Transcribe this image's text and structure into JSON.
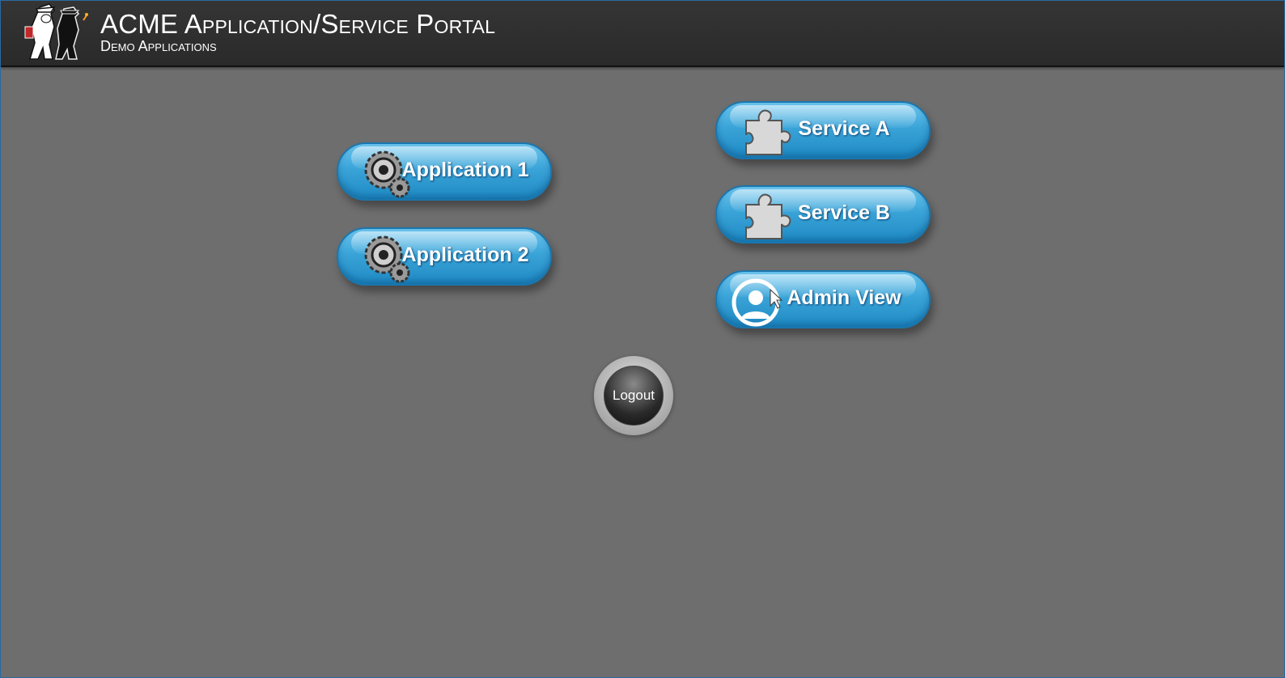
{
  "header": {
    "title": "ACME Application/Service Portal",
    "subtitle": "Demo Applications",
    "logo_icon": "spy-characters-logo"
  },
  "applications": [
    {
      "label": "Application 1",
      "icon": "gears-icon"
    },
    {
      "label": "Application 2",
      "icon": "gears-icon"
    }
  ],
  "services": [
    {
      "label": "Service A",
      "icon": "puzzle-piece-icon"
    },
    {
      "label": "Service B",
      "icon": "puzzle-piece-icon"
    },
    {
      "label": "Admin View",
      "icon": "admin-user-icon"
    }
  ],
  "logout": {
    "label": "Logout"
  },
  "colors": {
    "background": "#6e6e6e",
    "header": "#2f2f2f",
    "button_blue": "#3aa4d8"
  }
}
